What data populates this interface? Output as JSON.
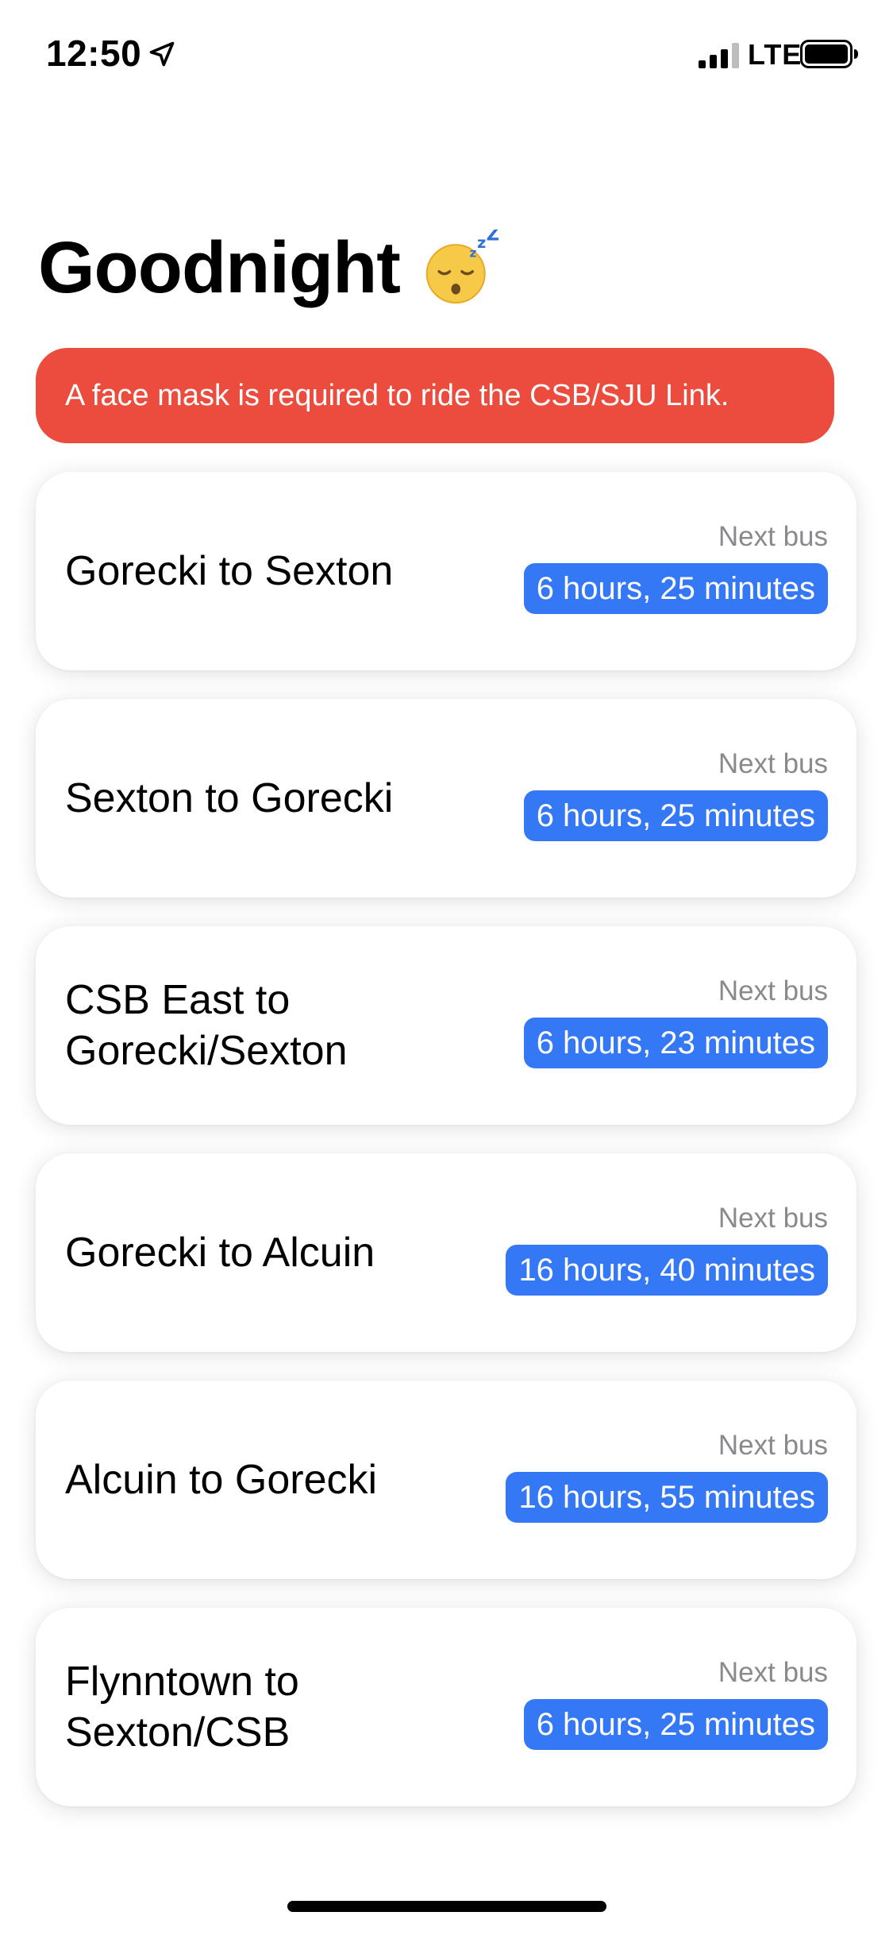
{
  "status_bar": {
    "time": "12:50",
    "network": "LTE",
    "icons": [
      "location-arrow-icon",
      "signal-bars-icon",
      "battery-icon"
    ]
  },
  "header": {
    "title": "Goodnight",
    "title_icon": "sleeping-face-icon"
  },
  "alert": {
    "text": "A face mask is required to ride the CSB/SJU Link.",
    "color": "#ec4c3e"
  },
  "routes": [
    {
      "name": "Gorecki to Sexton",
      "next_label": "Next bus",
      "eta": "6 hours, 25 minutes"
    },
    {
      "name": "Sexton to Gorecki",
      "next_label": "Next bus",
      "eta": "6 hours, 25 minutes"
    },
    {
      "name": "CSB East to Gorecki/Sexton",
      "next_label": "Next bus",
      "eta": "6 hours, 23 minutes"
    },
    {
      "name": "Gorecki to Alcuin",
      "next_label": "Next bus",
      "eta": "16 hours, 40 minutes"
    },
    {
      "name": "Alcuin to Gorecki",
      "next_label": "Next bus",
      "eta": "16 hours, 55 minutes"
    },
    {
      "name": "Flynntown to Sexton/CSB",
      "next_label": "Next bus",
      "eta": "6 hours, 25 minutes"
    }
  ],
  "colors": {
    "accent": "#3478f6",
    "alert": "#ec4c3e",
    "secondary_text": "#8a8a8e"
  }
}
